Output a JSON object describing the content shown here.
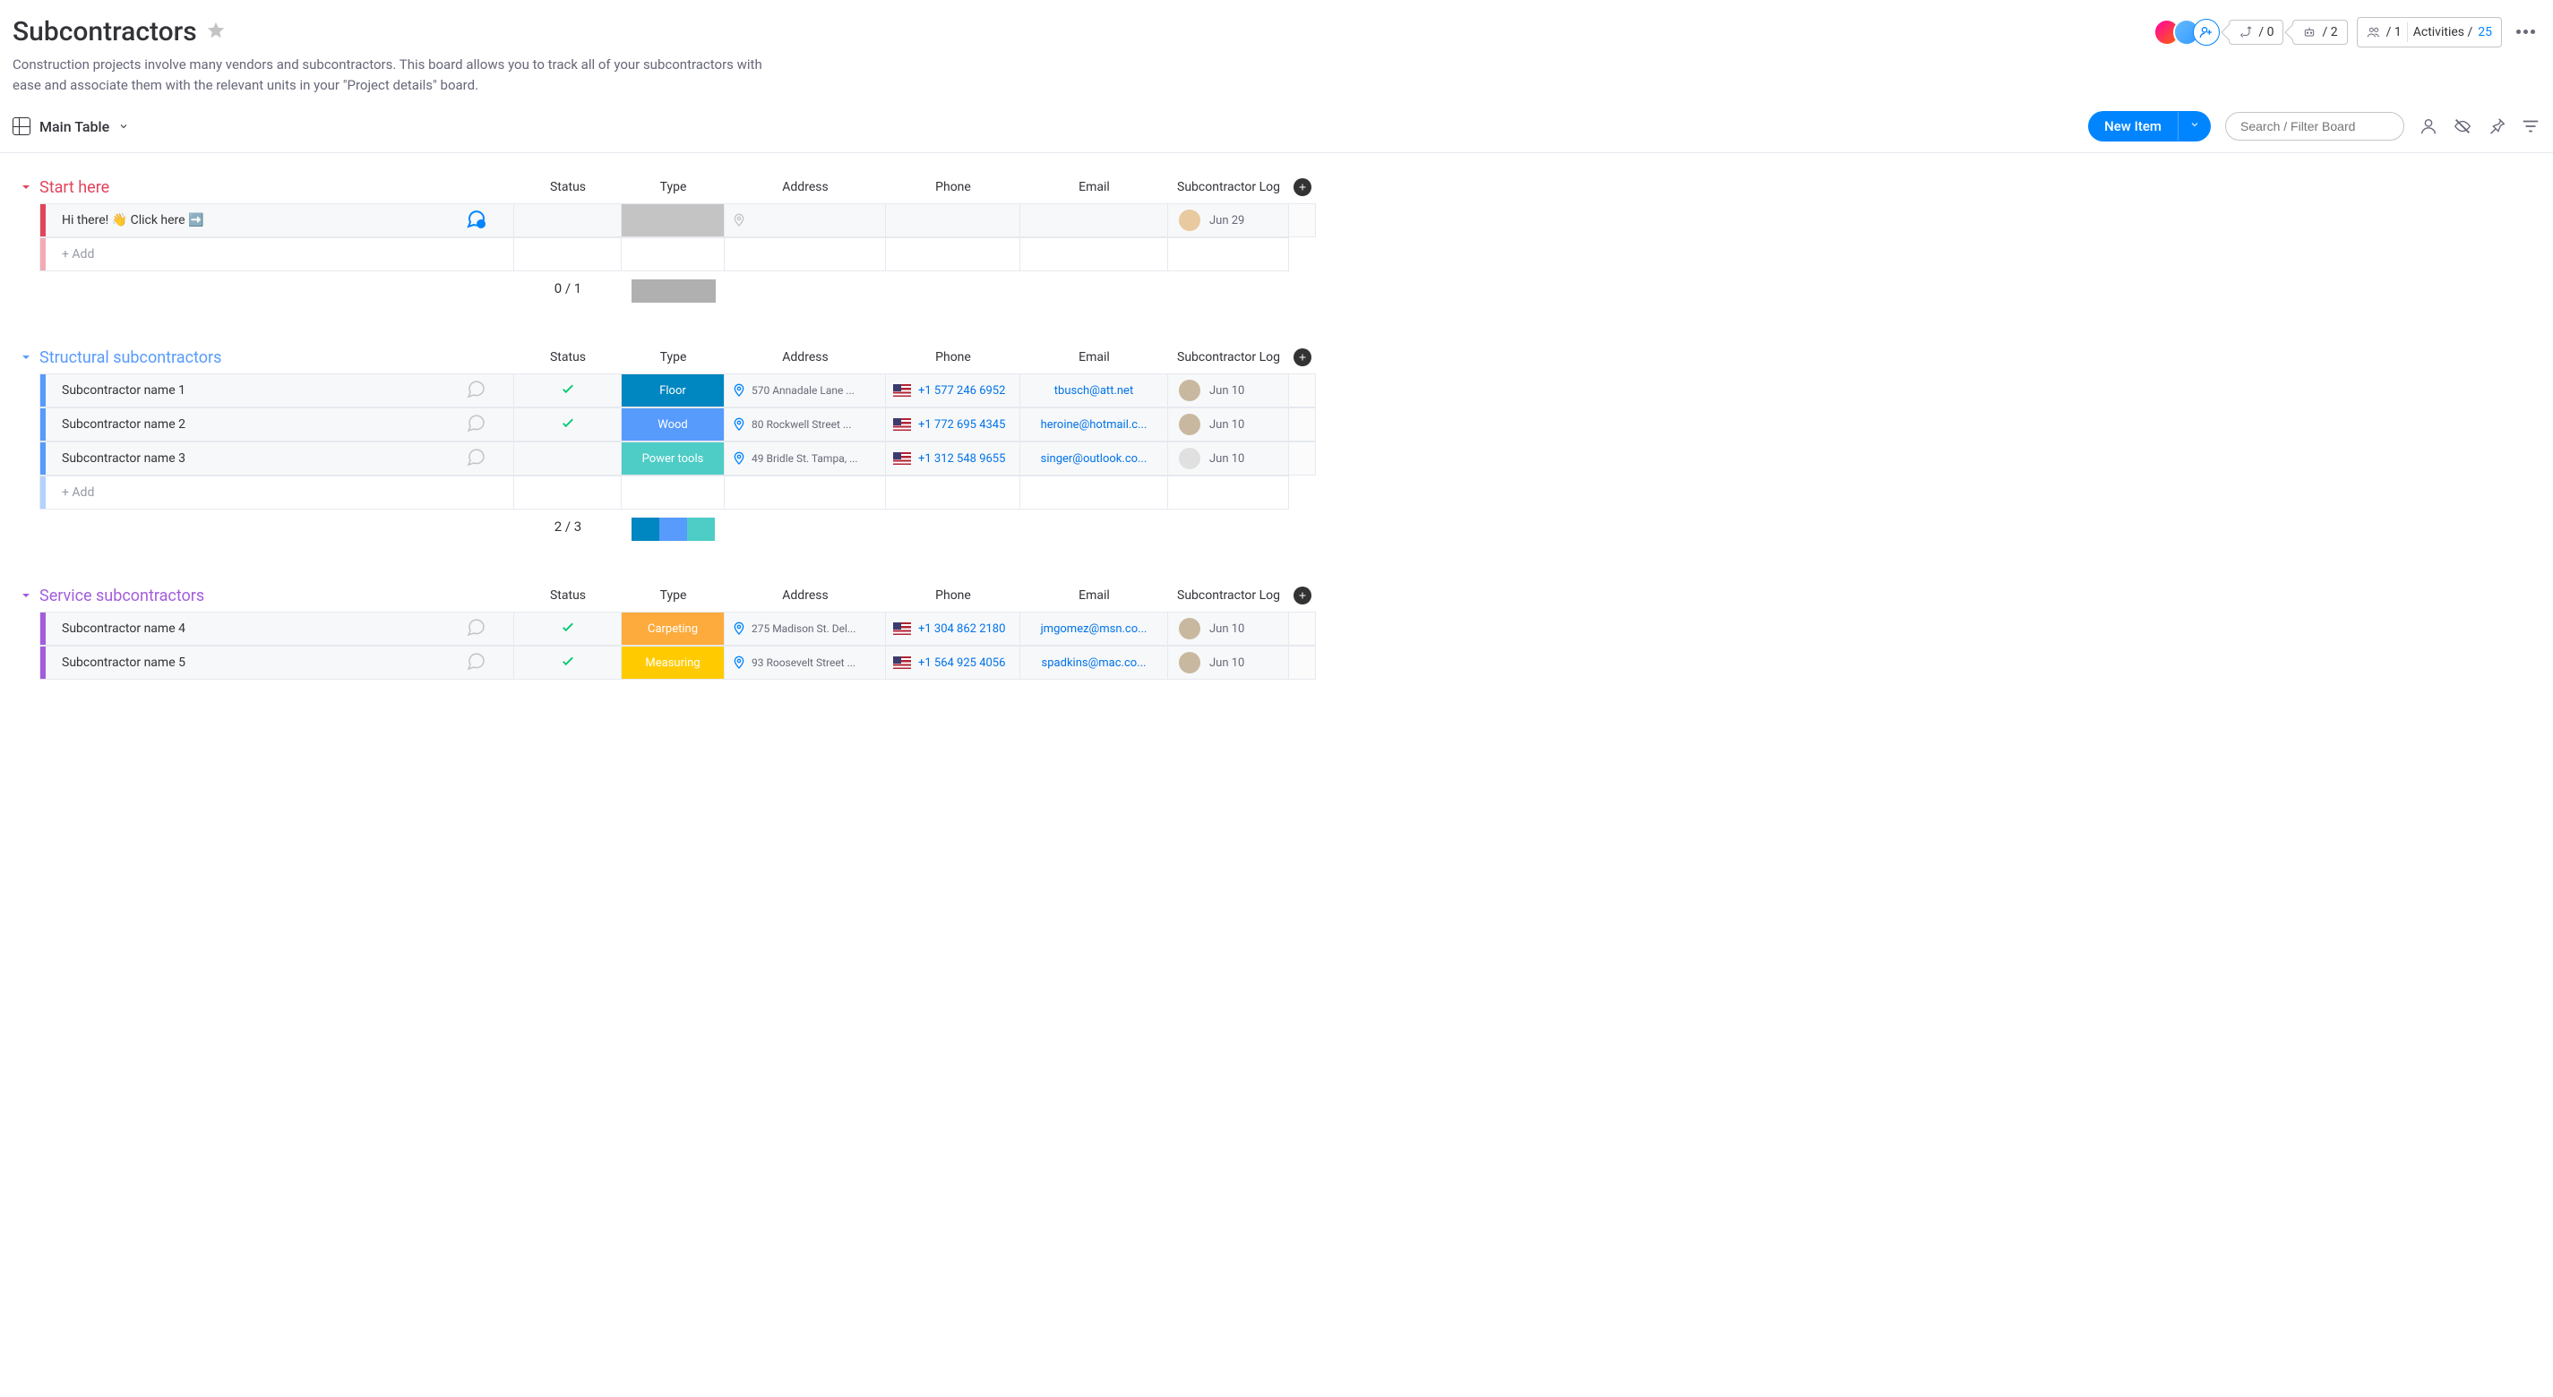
{
  "header": {
    "title": "Subcontractors",
    "subtitle": "Construction projects involve many vendors and subcontractors. This board allows you to track all of your subcontractors with ease and associate them with the relevant units in your \"Project details\" board.",
    "pill_integrations": "/ 0",
    "pill_automations": "/ 2",
    "pill_members": "/ 1",
    "activities_label": "Activities /",
    "activities_count": "25"
  },
  "toolbar": {
    "view_label": "Main Table",
    "new_item_label": "New Item",
    "search_placeholder": "Search / Filter Board"
  },
  "columns": {
    "status": "Status",
    "type": "Type",
    "address": "Address",
    "phone": "Phone",
    "email": "Email",
    "log": "Subcontractor Log"
  },
  "add_row_label": "+ Add",
  "groups": [
    {
      "id": "g1",
      "title": "Start here",
      "color": "#e2445c",
      "rows": [
        {
          "name": "Hi there! 👋 Click here ➡️",
          "comment_badge": "1",
          "comment_active": true,
          "status": "",
          "type": "",
          "type_color": "#c4c4c4",
          "address": "",
          "address_pin": true,
          "phone": "",
          "email": "",
          "log_date": "Jun 29",
          "log_avatar": "#e8c9a0"
        }
      ],
      "summary_count": "0 / 1",
      "summary_swatches": [
        "#b0b0b0"
      ]
    },
    {
      "id": "g2",
      "title": "Structural subcontractors",
      "color": "#579bfc",
      "rows": [
        {
          "name": "Subcontractor name 1",
          "comment_badge": "",
          "comment_active": false,
          "status": "check",
          "type": "Floor",
          "type_color": "#0086c0",
          "address": "570 Annadale Lane ...",
          "address_pin": true,
          "phone": "+1 577 246 6952",
          "email": "tbusch@att.net",
          "log_date": "Jun 10",
          "log_avatar": "#c9b8a0"
        },
        {
          "name": "Subcontractor name 2",
          "comment_badge": "",
          "comment_active": false,
          "status": "check",
          "type": "Wood",
          "type_color": "#579bfc",
          "address": "80 Rockwell Street ...",
          "address_pin": true,
          "phone": "+1 772 695 4345",
          "email": "heroine@hotmail.c...",
          "log_date": "Jun 10",
          "log_avatar": "#c9b8a0"
        },
        {
          "name": "Subcontractor name 3",
          "comment_badge": "",
          "comment_active": false,
          "status": "",
          "type": "Power tools",
          "type_color": "#4eccc6",
          "address": "49 Bridle St. Tampa, ...",
          "address_pin": true,
          "phone": "+1 312 548 9655",
          "email": "singer@outlook.co...",
          "log_date": "Jun 10",
          "log_avatar": "#e0e0e0"
        }
      ],
      "summary_count": "2 / 3",
      "summary_swatches": [
        "#0086c0",
        "#579bfc",
        "#4eccc6"
      ]
    },
    {
      "id": "g3",
      "title": "Service subcontractors",
      "color": "#a25ddc",
      "rows": [
        {
          "name": "Subcontractor name 4",
          "comment_badge": "",
          "comment_active": false,
          "status": "check",
          "type": "Carpeting",
          "type_color": "#fdab3d",
          "address": "275 Madison St. Del...",
          "address_pin": true,
          "phone": "+1 304 862 2180",
          "email": "jmgomez@msn.co...",
          "log_date": "Jun 10",
          "log_avatar": "#c9b8a0"
        },
        {
          "name": "Subcontractor name 5",
          "comment_badge": "",
          "comment_active": false,
          "status": "check",
          "type": "Measuring",
          "type_color": "#ffcb00",
          "address": "93 Roosevelt Street ...",
          "address_pin": true,
          "phone": "+1 564 925 4056",
          "email": "spadkins@mac.co...",
          "log_date": "Jun 10",
          "log_avatar": "#c9b8a0"
        }
      ],
      "summary_count": "",
      "summary_swatches": []
    }
  ]
}
